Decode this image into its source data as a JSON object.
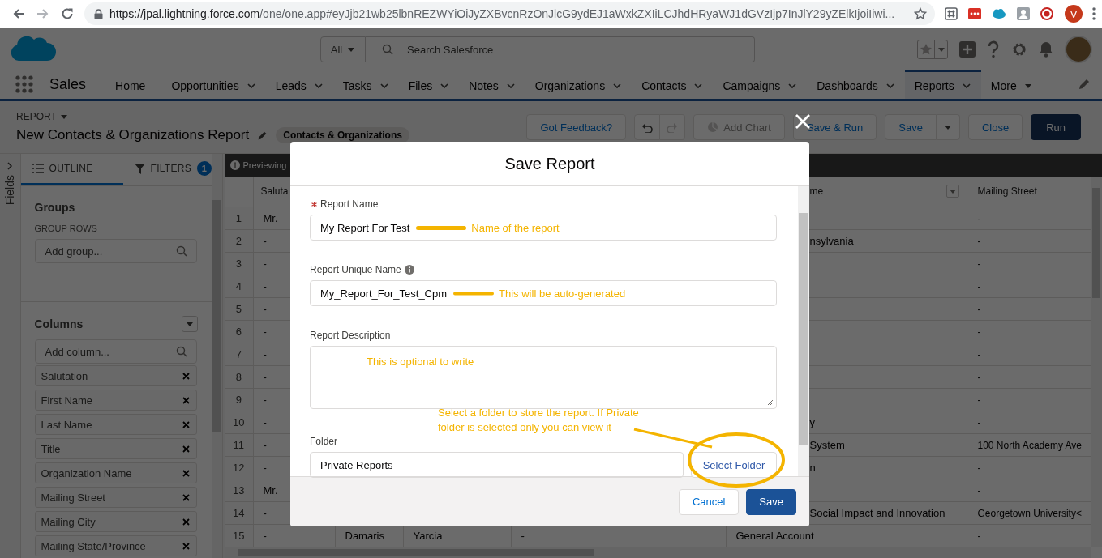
{
  "browser": {
    "url_host": "https://jpal.lightning.force.com",
    "url_path": "/one/one.app#eyJjb21wb25lbnREZWYiOiJyZXBvcnRzOnJlcG9ydEJ1aWxkZXIiLCJhdHRyaWJ1dGVzIjp7InJlY29yZElkIjoiIiwi...",
    "profile_initial": "V"
  },
  "header": {
    "search_scope": "All",
    "search_placeholder": "Search Salesforce"
  },
  "nav": {
    "app_name": "Sales",
    "items": [
      {
        "label": "Home",
        "selected": false,
        "kind": "plain"
      },
      {
        "label": "Opportunities",
        "selected": false,
        "kind": "menu"
      },
      {
        "label": "Leads",
        "selected": false,
        "kind": "menu"
      },
      {
        "label": "Tasks",
        "selected": false,
        "kind": "menu"
      },
      {
        "label": "Files",
        "selected": false,
        "kind": "menu"
      },
      {
        "label": "Notes",
        "selected": false,
        "kind": "menu"
      },
      {
        "label": "Organizations",
        "selected": false,
        "kind": "menu"
      },
      {
        "label": "Contacts",
        "selected": false,
        "kind": "menu"
      },
      {
        "label": "Campaigns",
        "selected": false,
        "kind": "menu"
      },
      {
        "label": "Dashboards",
        "selected": false,
        "kind": "menu"
      },
      {
        "label": "Reports",
        "selected": true,
        "kind": "menu"
      },
      {
        "label": "More",
        "selected": false,
        "kind": "more"
      }
    ]
  },
  "report": {
    "type_label": "REPORT",
    "title": "New Contacts & Organizations Report",
    "report_type": "Contacts & Organizations",
    "buttons": [
      {
        "label": "Got Feedback?",
        "kind": "text",
        "disabled": false
      },
      {
        "kind": "undo",
        "disabled": false
      },
      {
        "kind": "redo",
        "disabled": true
      },
      {
        "label": "Add Chart",
        "kind": "chart",
        "disabled": true
      },
      {
        "label": "Save & Run",
        "kind": "text",
        "disabled": false
      },
      {
        "label": "Save",
        "kind": "split",
        "disabled": false
      },
      {
        "label": "Close",
        "kind": "text",
        "disabled": false
      },
      {
        "label": "Run",
        "kind": "primary",
        "disabled": false
      }
    ]
  },
  "outline": {
    "fields_label": "Fields",
    "tabs": [
      {
        "label": "OUTLINE",
        "selected": true
      },
      {
        "label": "FILTERS",
        "selected": false,
        "count": "1"
      }
    ],
    "groups_title": "Groups",
    "group_rows_label": "GROUP ROWS",
    "group_placeholder": "Add group...",
    "columns_title": "Columns",
    "column_placeholder": "Add column...",
    "columns": [
      "Salutation",
      "First Name",
      "Last Name",
      "Title",
      "Organization Name",
      "Mailing Street",
      "Mailing City",
      "Mailing State/Province"
    ]
  },
  "table": {
    "notice": "Previewing",
    "headers": {
      "column_1": {
        "label": "Saluta",
        "menu": false
      },
      "column_5": {
        "label": "me",
        "menu": true
      },
      "column_6": {
        "label": "Mailing Street",
        "menu": false
      }
    },
    "rows": [
      {
        "number": "1",
        "column_1": "Mr.",
        "column_6": "-"
      },
      {
        "number": "2",
        "column_1": "-",
        "column_5": "nsylvania",
        "column_6": "-"
      },
      {
        "number": "3",
        "column_1": "-",
        "column_6": "-"
      },
      {
        "number": "4",
        "column_1": "-",
        "column_6": "-"
      },
      {
        "number": "5",
        "column_1": "-",
        "column_6": "-"
      },
      {
        "number": "6",
        "column_1": "-",
        "column_6": "-"
      },
      {
        "number": "7",
        "column_1": "-",
        "column_6": "-"
      },
      {
        "number": "8",
        "column_1": "-",
        "column_6": "-"
      },
      {
        "number": "9",
        "column_1": "-",
        "column_6": "-"
      },
      {
        "number": "10",
        "column_1": "-",
        "column_5": "y",
        "column_6": "-"
      },
      {
        "number": "11",
        "column_1": "-",
        "column_5": "System",
        "column_6": "100 North Academy Ave"
      },
      {
        "number": "12",
        "column_1": "-",
        "column_5": "n",
        "column_6": "-"
      },
      {
        "number": "13",
        "column_1": "Mr.",
        "column_6": "-"
      },
      {
        "number": "14",
        "column_1": "-",
        "column_5": "Social Impact and Innovation",
        "column_6": "Georgetown University<"
      },
      {
        "number": "15",
        "column_1": "-",
        "column_2": "Damaris",
        "column_3": "Yarcia",
        "column_4": "-",
        "column_5": "General Account",
        "column_6": "-"
      }
    ]
  },
  "dialog": {
    "title": "Save Report",
    "fields": [
      {
        "label": "Report Name",
        "required": true,
        "info": false,
        "kind": "input",
        "value": "My Report For Test",
        "note": {
          "kind": "underline",
          "text": "Name of the report"
        }
      },
      {
        "label": "Report Unique Name",
        "required": false,
        "info": true,
        "kind": "input",
        "value": "My_Report_For_Test_Cpm",
        "note": {
          "kind": "underline",
          "text": "This will be auto-generated"
        }
      },
      {
        "label": "Report Description",
        "required": false,
        "info": false,
        "kind": "textarea",
        "note": {
          "kind": "inside",
          "text": "This is optional to write"
        }
      },
      {
        "label": "Folder",
        "required": false,
        "info": false,
        "kind": "folder",
        "value": "Private Reports",
        "button": "Select Folder",
        "note": {
          "kind": "callout",
          "text": "Select a folder to store the report. If Private folder is selected only you can view it"
        }
      }
    ],
    "buttons": [
      {
        "label": "Cancel",
        "kind": "neutral"
      },
      {
        "label": "Save",
        "kind": "brand"
      }
    ]
  }
}
